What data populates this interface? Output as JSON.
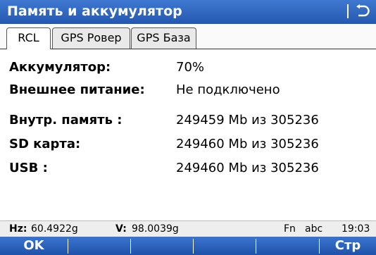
{
  "window": {
    "title": "Память и аккумулятор",
    "back_icon": "back-arrow-icon"
  },
  "tabs": [
    {
      "label": "RCL",
      "active": true
    },
    {
      "label": "GPS Ровер",
      "active": false
    },
    {
      "label": "GPS База",
      "active": false
    }
  ],
  "info": {
    "battery_label": "Аккумулятор:",
    "battery_value": "70%",
    "external_power_label": "Внешнее питание:",
    "external_power_value": "Не подключено",
    "internal_memory_label": "Внутр. память :",
    "internal_memory_value": "249459 Mb из 305236",
    "sd_card_label": "SD карта:",
    "sd_card_value": "249460 Mb из 305236",
    "usb_label": "USB :",
    "usb_value": "249460 Mb из 305236"
  },
  "status_bar": {
    "hz_label": "Hz:",
    "hz_value": "60.4922g",
    "v_label": "V:",
    "v_value": "98.0039g",
    "fn": "Fn",
    "input_mode": "abc",
    "time": "19:03"
  },
  "softkeys": {
    "f1": "OK",
    "f6": "Стр"
  },
  "colors": {
    "title_bar": "#2f66c2",
    "accent_text": "#ffffff"
  }
}
